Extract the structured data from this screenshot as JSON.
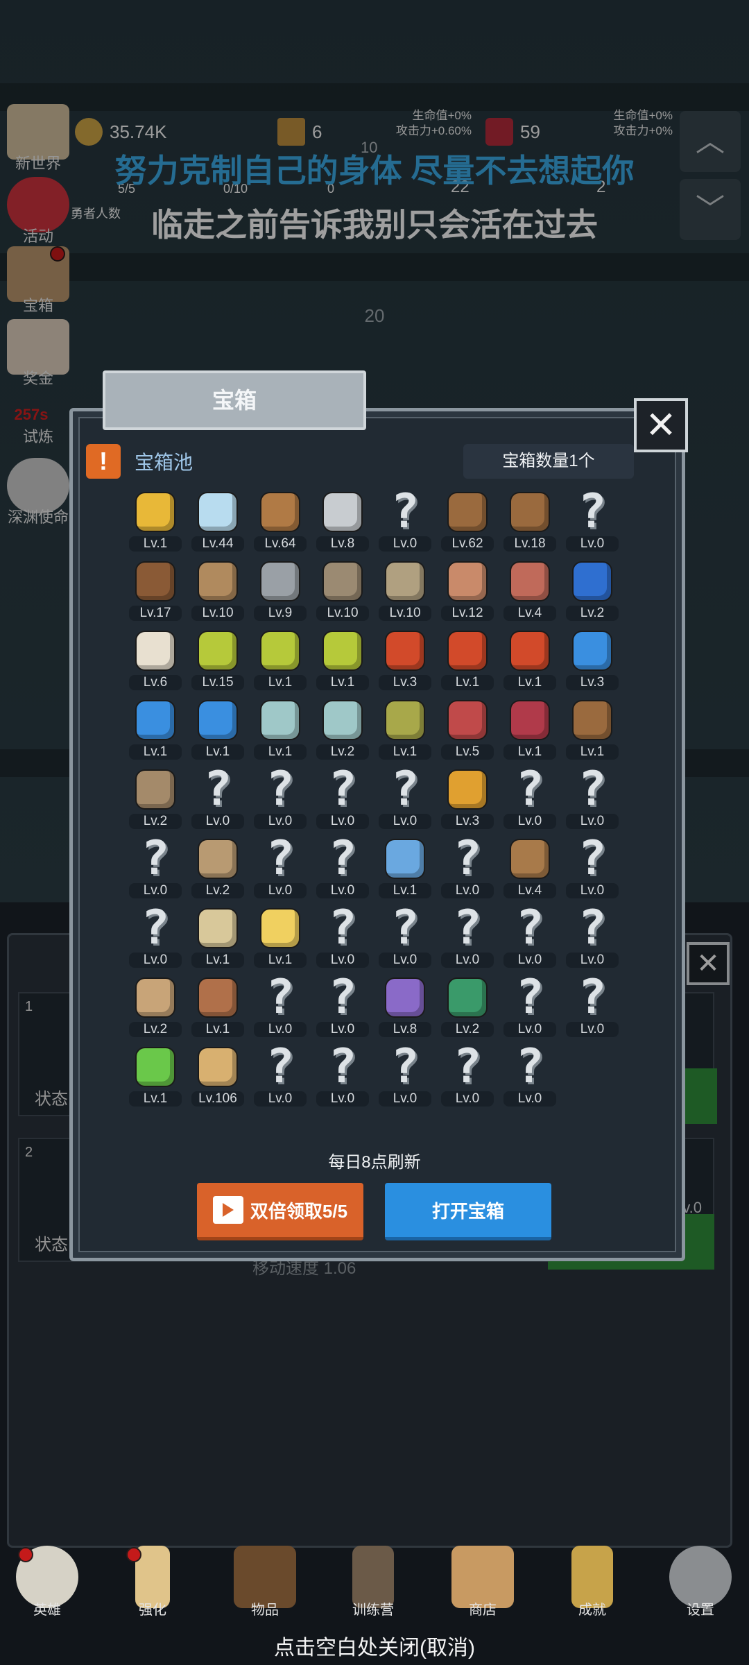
{
  "hud": {
    "gold": "35.74K",
    "wood": "6",
    "gem": "59",
    "heroes_count": "5/5",
    "slot2": "0/10",
    "slot3": "0",
    "slot4": "22",
    "slot5": "2",
    "heroes_label": "勇者人数",
    "stat_left": [
      "生命值+0%",
      "攻击力+0.60%"
    ],
    "stat_right": [
      "生命值+0%",
      "攻击力+0%"
    ],
    "mid_number": "10"
  },
  "lyrics": {
    "line1": "努力克制自己的身体 尽量不去想起你",
    "line2": "临走之前告诉我别只会活在过去"
  },
  "wave_number": "20",
  "left_menu": [
    {
      "label": "新世界",
      "icon": "scroll-icon"
    },
    {
      "label": "活动",
      "icon": "heart-icon"
    },
    {
      "label": "宝箱",
      "icon": "chest-icon"
    },
    {
      "label": "奖金",
      "icon": "envelope-icon"
    },
    {
      "label": "试炼",
      "icon": "trial-icon"
    },
    {
      "label": "深渊使命",
      "icon": "orb-icon"
    }
  ],
  "trial_timer": "257s",
  "background_panel": {
    "card1_num": "1",
    "card2_num": "2",
    "status_label": "状态",
    "move_speed": "移动速度 1.06",
    "right_lv": "Lv.0"
  },
  "modal": {
    "tab_title": "宝箱",
    "pool_title": "宝箱池",
    "chest_count": "宝箱数量1个",
    "refresh_text": "每日8点刷新",
    "double_button": "双倍领取5/5",
    "open_button": "打开宝箱",
    "items": [
      {
        "icon": "crown",
        "lv": "Lv.1"
      },
      {
        "icon": "diamond",
        "lv": "Lv.44"
      },
      {
        "icon": "wood-sword",
        "lv": "Lv.64"
      },
      {
        "icon": "iron-sword",
        "lv": "Lv.8"
      },
      {
        "icon": "unknown",
        "lv": "Lv.0"
      },
      {
        "icon": "backpack",
        "lv": "Lv.62"
      },
      {
        "icon": "backpack",
        "lv": "Lv.18"
      },
      {
        "icon": "unknown",
        "lv": "Lv.0"
      },
      {
        "icon": "leather-helmet",
        "lv": "Lv.17"
      },
      {
        "icon": "dagger",
        "lv": "Lv.10"
      },
      {
        "icon": "knight-helmet",
        "lv": "Lv.9"
      },
      {
        "icon": "hammer",
        "lv": "Lv.10"
      },
      {
        "icon": "great-helm",
        "lv": "Lv.10"
      },
      {
        "icon": "ham",
        "lv": "Lv.12"
      },
      {
        "icon": "steak",
        "lv": "Lv.4"
      },
      {
        "icon": "blue-pouch",
        "lv": "Lv.2"
      },
      {
        "icon": "rice-bowl",
        "lv": "Lv.6"
      },
      {
        "icon": "yellow-potion",
        "lv": "Lv.15"
      },
      {
        "icon": "yellow-potion",
        "lv": "Lv.1"
      },
      {
        "icon": "yellow-potion",
        "lv": "Lv.1"
      },
      {
        "icon": "red-potion",
        "lv": "Lv.3"
      },
      {
        "icon": "red-potion",
        "lv": "Lv.1"
      },
      {
        "icon": "red-potion",
        "lv": "Lv.1"
      },
      {
        "icon": "blue-potion",
        "lv": "Lv.3"
      },
      {
        "icon": "blue-potion",
        "lv": "Lv.1"
      },
      {
        "icon": "blue-potion",
        "lv": "Lv.1"
      },
      {
        "icon": "empty-bottle",
        "lv": "Lv.1"
      },
      {
        "icon": "empty-bottle",
        "lv": "Lv.2"
      },
      {
        "icon": "green-bottle",
        "lv": "Lv.1"
      },
      {
        "icon": "red-bottle",
        "lv": "Lv.5"
      },
      {
        "icon": "winged-boot",
        "lv": "Lv.1"
      },
      {
        "icon": "boot",
        "lv": "Lv.1"
      },
      {
        "icon": "shoe",
        "lv": "Lv.2"
      },
      {
        "icon": "unknown",
        "lv": "Lv.0"
      },
      {
        "icon": "unknown",
        "lv": "Lv.0"
      },
      {
        "icon": "unknown",
        "lv": "Lv.0"
      },
      {
        "icon": "unknown",
        "lv": "Lv.0"
      },
      {
        "icon": "torch-staff",
        "lv": "Lv.3"
      },
      {
        "icon": "unknown",
        "lv": "Lv.0"
      },
      {
        "icon": "unknown",
        "lv": "Lv.0"
      },
      {
        "icon": "unknown",
        "lv": "Lv.0"
      },
      {
        "icon": "wood-staff",
        "lv": "Lv.2"
      },
      {
        "icon": "unknown",
        "lv": "Lv.0"
      },
      {
        "icon": "unknown",
        "lv": "Lv.0"
      },
      {
        "icon": "blue-wand",
        "lv": "Lv.1"
      },
      {
        "icon": "unknown",
        "lv": "Lv.0"
      },
      {
        "icon": "leather-bag",
        "lv": "Lv.4"
      },
      {
        "icon": "unknown",
        "lv": "Lv.0"
      },
      {
        "icon": "unknown",
        "lv": "Lv.0"
      },
      {
        "icon": "club",
        "lv": "Lv.1"
      },
      {
        "icon": "cheese",
        "lv": "Lv.1"
      },
      {
        "icon": "unknown",
        "lv": "Lv.0"
      },
      {
        "icon": "unknown",
        "lv": "Lv.0"
      },
      {
        "icon": "unknown",
        "lv": "Lv.0"
      },
      {
        "icon": "unknown",
        "lv": "Lv.0"
      },
      {
        "icon": "unknown",
        "lv": "Lv.0"
      },
      {
        "icon": "bow",
        "lv": "Lv.2"
      },
      {
        "icon": "quiver",
        "lv": "Lv.1"
      },
      {
        "icon": "unknown",
        "lv": "Lv.0"
      },
      {
        "icon": "unknown",
        "lv": "Lv.0"
      },
      {
        "icon": "monster-mask",
        "lv": "Lv.8"
      },
      {
        "icon": "emblem-shield",
        "lv": "Lv.2"
      },
      {
        "icon": "unknown",
        "lv": "Lv.0"
      },
      {
        "icon": "unknown",
        "lv": "Lv.0"
      },
      {
        "icon": "green-wand",
        "lv": "Lv.1"
      },
      {
        "icon": "beer-mug",
        "lv": "Lv.106"
      },
      {
        "icon": "unknown",
        "lv": "Lv.0"
      },
      {
        "icon": "unknown",
        "lv": "Lv.0"
      },
      {
        "icon": "unknown",
        "lv": "Lv.0"
      },
      {
        "icon": "unknown",
        "lv": "Lv.0"
      },
      {
        "icon": "unknown",
        "lv": "Lv.0"
      }
    ]
  },
  "bottom_nav": [
    {
      "label": "英雄",
      "icon": "skull-icon"
    },
    {
      "label": "强化",
      "icon": "candle-icon"
    },
    {
      "label": "物品",
      "icon": "book-icon"
    },
    {
      "label": "训练营",
      "icon": "lantern-icon"
    },
    {
      "label": "商店",
      "icon": "mug-icon"
    },
    {
      "label": "成就",
      "icon": "key-icon"
    },
    {
      "label": "设置",
      "icon": "gear-icon"
    }
  ],
  "close_hint": "点击空白处关闭(取消)",
  "colors": {
    "lyric_blue": "#3aa6e0",
    "orange_button": "#d9622a",
    "blue_button": "#2a8fe0",
    "timer_red": "#d02020"
  },
  "unknown_glyph": "?"
}
